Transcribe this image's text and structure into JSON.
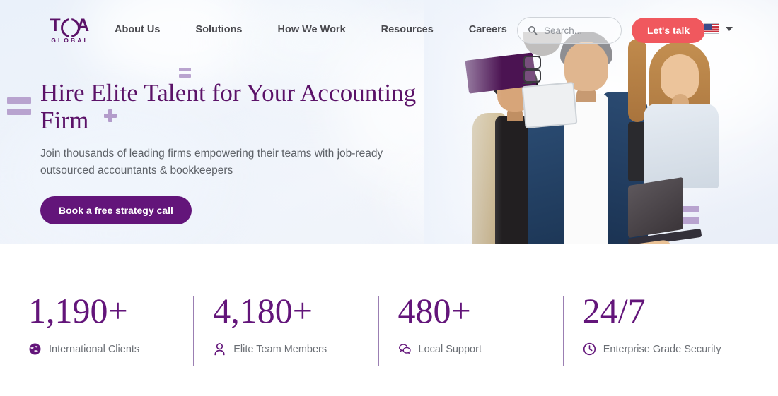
{
  "brand": {
    "logo_t": "T",
    "logo_a": "A",
    "logo_sub": "GLOBAL",
    "accent_purple": "#63157a",
    "accent_coral": "#f0585e",
    "deco_purple": "#b39ccb"
  },
  "nav": {
    "links": [
      {
        "label": "About Us"
      },
      {
        "label": "Solutions"
      },
      {
        "label": "How We Work"
      },
      {
        "label": "Resources"
      },
      {
        "label": "Careers"
      }
    ],
    "search": {
      "placeholder": "Search...",
      "icon": "search-icon"
    },
    "cta": {
      "label": "Let's talk"
    },
    "language": {
      "flag": "us-flag-icon",
      "chevron": "chevron-down-icon"
    }
  },
  "hero": {
    "headline": "Hire Elite Talent for Your Accounting Firm",
    "subhead": "Join thousands of leading firms empowering their teams with job-ready outsourced accountants & bookkeepers",
    "cta": {
      "label": "Book a free strategy call"
    }
  },
  "stats": [
    {
      "value": "1,190+",
      "label": "International Clients",
      "icon": "globe-icon"
    },
    {
      "value": "4,180+",
      "label": "Elite Team Members",
      "icon": "person-icon"
    },
    {
      "value": "480+",
      "label": "Local Support",
      "icon": "chat-bubbles-icon"
    },
    {
      "value": "24/7",
      "label": "Enterprise Grade Security",
      "icon": "clock-icon"
    }
  ]
}
